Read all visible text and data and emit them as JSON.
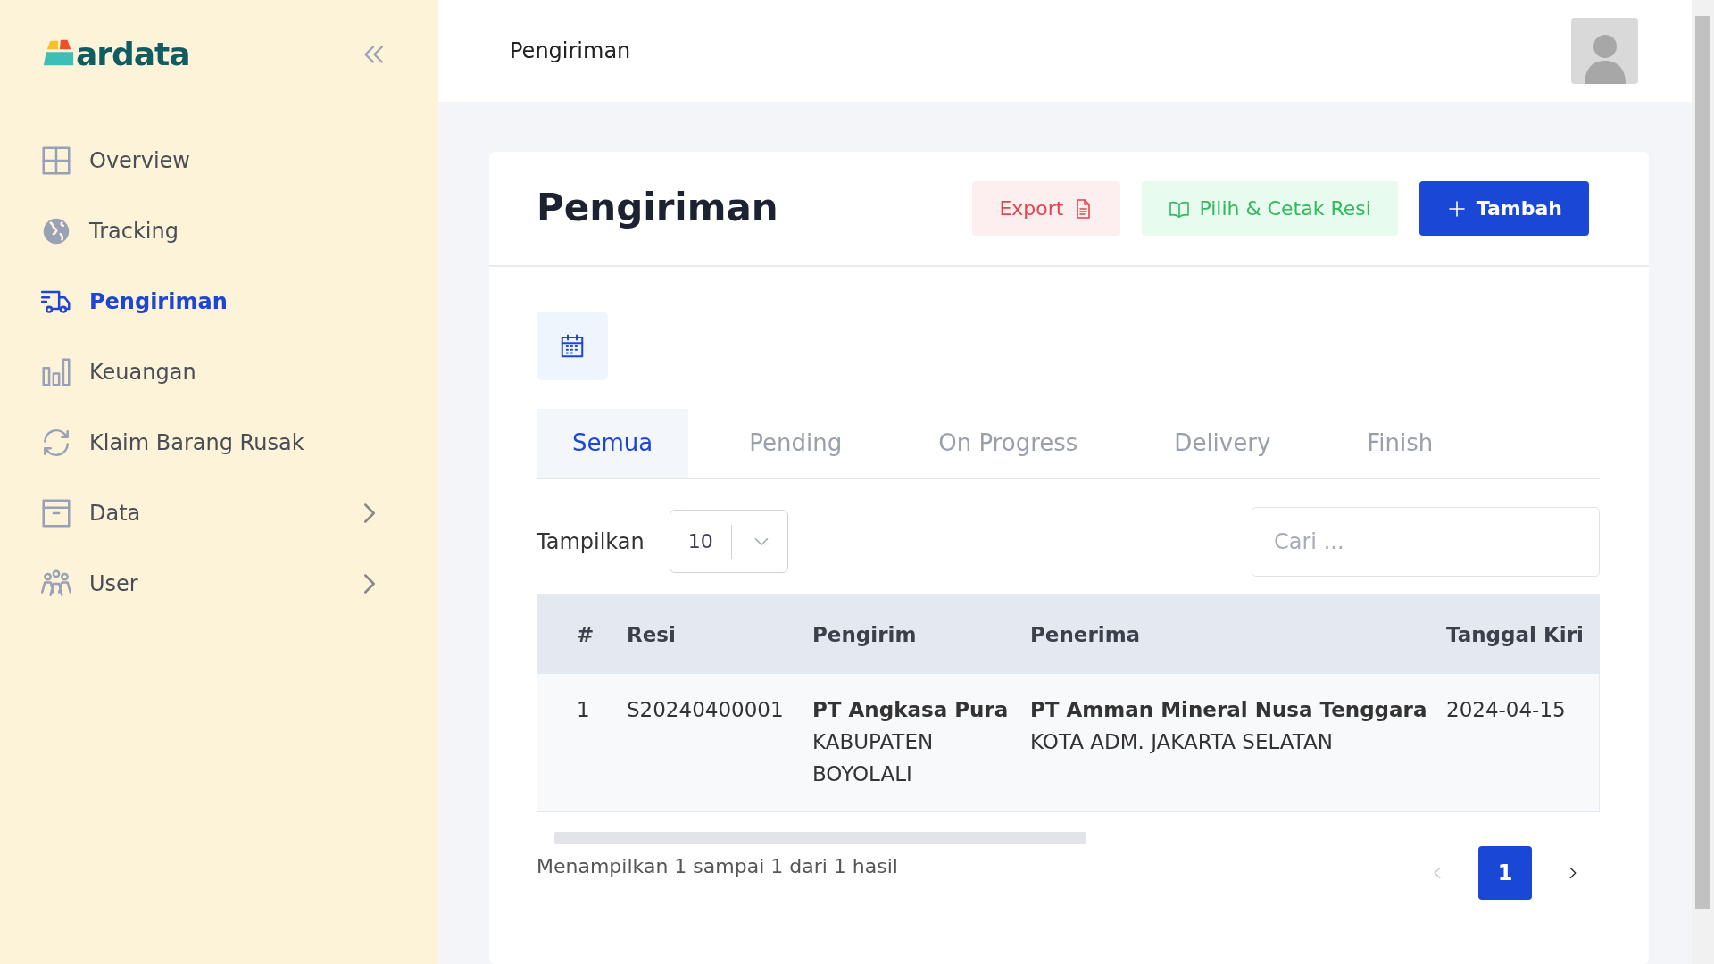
{
  "sidebar": {
    "logo": "ardata",
    "items": [
      {
        "label": "Overview",
        "kind": "grid",
        "selected": false,
        "has_submenu": false
      },
      {
        "label": "Tracking",
        "kind": "globe",
        "selected": false,
        "has_submenu": false
      },
      {
        "label": "Pengiriman",
        "kind": "truck",
        "selected": true,
        "has_submenu": false
      },
      {
        "label": "Keuangan",
        "kind": "bars",
        "selected": false,
        "has_submenu": false
      },
      {
        "label": "Klaim Barang Rusak",
        "kind": "refresh",
        "selected": false,
        "has_submenu": false
      },
      {
        "label": "Data",
        "kind": "archive",
        "selected": false,
        "has_submenu": true
      },
      {
        "label": "User",
        "kind": "users",
        "selected": false,
        "has_submenu": true
      }
    ]
  },
  "header": {
    "title": "Pengiriman"
  },
  "card": {
    "title": "Pengiriman",
    "buttons": [
      {
        "label": "Export",
        "kind": "export"
      },
      {
        "label": "Pilih & Cetak Resi",
        "kind": "print"
      },
      {
        "label": "Tambah",
        "kind": "add"
      }
    ],
    "tabs": [
      {
        "label": "Semua",
        "selected": true
      },
      {
        "label": "Pending",
        "selected": false
      },
      {
        "label": "On Progress",
        "selected": false
      },
      {
        "label": "Delivery",
        "selected": false
      },
      {
        "label": "Finish",
        "selected": false
      }
    ],
    "show_label": "Tampilkan",
    "page_size": "10",
    "search": {
      "placeholder": "Cari ..."
    },
    "table": {
      "columns": [
        "#",
        "Resi",
        "Pengirim",
        "Penerima",
        "Tanggal Kiri"
      ],
      "rows": [
        {
          "no": "1",
          "resi": "S20240400001",
          "sender": {
            "name": "PT Angkasa Pura",
            "city": "KABUPATEN BOYOLALI"
          },
          "receiver": {
            "name": "PT Amman Mineral Nusa Tenggara",
            "city": "KOTA ADM. JAKARTA SELATAN"
          },
          "date": "2024-04-15"
        }
      ]
    },
    "summary": "Menampilkan 1 sampai 1 dari 1 hasil",
    "pagination": {
      "prev_disabled": true,
      "pages": [
        {
          "label": "1",
          "selected": true
        }
      ]
    }
  }
}
